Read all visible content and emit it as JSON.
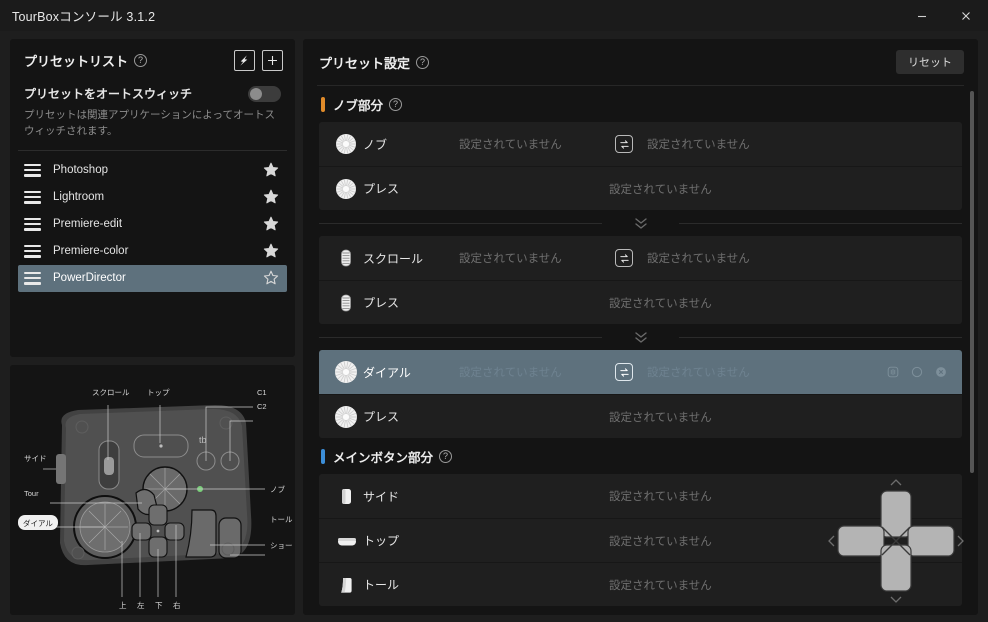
{
  "window": {
    "title": "TourBoxコンソール 3.1.2",
    "minimize_label": "minimize",
    "close_label": "close"
  },
  "preset_panel": {
    "title": "プリセットリスト",
    "help_glyph": "?",
    "import_button_label": "インポート",
    "add_button_label": "追加",
    "auto_switch": {
      "label": "プリセットをオートスウィッチ",
      "enabled": false,
      "description": "プリセットは関連アプリケーションによってオートスウィッチされます。"
    },
    "items": [
      {
        "name": "Photoshop",
        "favorite": true,
        "selected": false
      },
      {
        "name": "Lightroom",
        "favorite": true,
        "selected": false
      },
      {
        "name": "Premiere-edit",
        "favorite": true,
        "selected": false
      },
      {
        "name": "Premiere-color",
        "favorite": true,
        "selected": false
      },
      {
        "name": "PowerDirector",
        "favorite": false,
        "selected": true
      }
    ]
  },
  "device_diagram": {
    "labels": {
      "scroll": "スクロール",
      "top": "トップ",
      "c1": "C1",
      "c2": "C2",
      "side": "サイド",
      "tour": "Tour",
      "dial": "ダイアル",
      "knob": "ノブ",
      "tall": "トール",
      "short": "ショート",
      "up": "上",
      "left": "左",
      "down": "下",
      "right": "右"
    },
    "highlighted_label": "ダイアル"
  },
  "settings_panel": {
    "title": "プリセット設定",
    "reset_label": "リセット",
    "unassigned_text": "設定されていません",
    "sections": [
      {
        "title": "ノブ部分",
        "color": "#e08b2a",
        "groups": [
          {
            "icon": "knob-icon",
            "rows": [
              {
                "label": "ノブ",
                "left_value": "設定されていません",
                "has_swap": true,
                "right_value": "設定されていません",
                "highlighted": false,
                "actions": false
              },
              {
                "label": "プレス",
                "center_value": "設定されていません",
                "has_swap": false,
                "highlighted": false,
                "actions": false
              }
            ]
          },
          {
            "icon": "scroll-icon",
            "rows": [
              {
                "label": "スクロール",
                "left_value": "設定されていません",
                "has_swap": true,
                "right_value": "設定されていません",
                "highlighted": false,
                "actions": false
              },
              {
                "label": "プレス",
                "center_value": "設定されていません",
                "has_swap": false,
                "highlighted": false,
                "actions": false
              }
            ]
          },
          {
            "icon": "dial-icon",
            "rows": [
              {
                "label": "ダイアル",
                "left_value": "設定されていません",
                "has_swap": true,
                "right_value": "設定されていません",
                "highlighted": true,
                "actions": true
              },
              {
                "label": "プレス",
                "center_value": "設定されていません",
                "has_swap": false,
                "highlighted": false,
                "actions": false
              }
            ]
          }
        ]
      },
      {
        "title": "メインボタン部分",
        "color": "#3c8ed8",
        "groups": [
          {
            "icon": "button-icon",
            "rows": [
              {
                "label": "サイド",
                "center_value": "設定されていません",
                "has_swap": false,
                "highlighted": false,
                "actions": false
              },
              {
                "label": "トップ",
                "center_value": "設定されていません",
                "has_swap": false,
                "highlighted": false,
                "actions": false
              },
              {
                "label": "トール",
                "center_value": "設定されていません",
                "has_swap": false,
                "highlighted": false,
                "actions": false
              }
            ]
          }
        ]
      }
    ],
    "row_actions": [
      "haptic-icon",
      "record-icon",
      "clear-icon"
    ],
    "scroll_position_percent": 0
  }
}
